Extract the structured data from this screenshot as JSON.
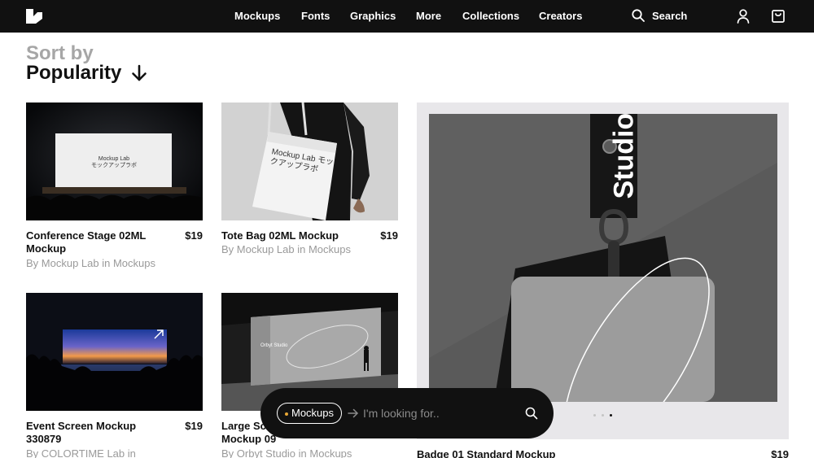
{
  "nav": {
    "items": [
      {
        "label": "Mockups"
      },
      {
        "label": "Fonts"
      },
      {
        "label": "Graphics"
      },
      {
        "label": "More"
      },
      {
        "label": "Collections"
      },
      {
        "label": "Creators"
      }
    ],
    "search_label": "Search",
    "icons": {
      "logo": "brand-logo",
      "search": "search-icon",
      "user": "user-icon",
      "cart": "cart-icon"
    }
  },
  "sort": {
    "label": "Sort by",
    "value": "Popularity",
    "icon": "arrow-down-icon"
  },
  "products": [
    {
      "title": "Conference Stage 02ML Mockup",
      "price": "$19",
      "subtitle": "By Mockup Lab in Mockups",
      "image_text": "Mockup Lab\nモックアップラボ"
    },
    {
      "title": "Tote Bag 02ML Mockup",
      "price": "$19",
      "subtitle": "By Mockup Lab in Mockups",
      "image_text": "Mockup Lab モックアップラボ"
    },
    {
      "title": "Event Screen Mockup 330879",
      "price": "$19",
      "subtitle": "By COLORTIME Lab in"
    },
    {
      "title": "Large Sc... Mockup 09",
      "title_line1": "Large Sc",
      "title_line2": "Mockup 09",
      "price": "",
      "subtitle": "By Orbyt Studio in Mockups",
      "image_text": "Orbyt Studio"
    },
    {
      "title": "Badge 01 Standard Mockup",
      "price": "$19",
      "subtitle": "",
      "image_text": "Studio"
    }
  ],
  "carousel": {
    "count": 3,
    "active": 3
  },
  "search_bar": {
    "category": "Mockups",
    "placeholder": "I'm looking for..",
    "icons": {
      "arrow": "arrow-right-icon",
      "search": "search-icon"
    }
  },
  "colors": {
    "topbar": "#111111",
    "accent_dot": "#e8a735",
    "muted_text": "#9a9a9a"
  }
}
